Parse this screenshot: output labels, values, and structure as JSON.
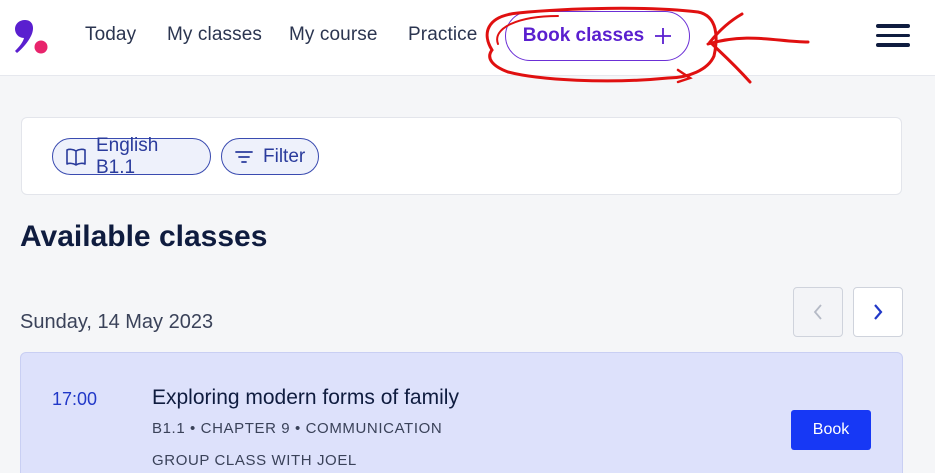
{
  "nav": {
    "items": [
      {
        "label": "Today"
      },
      {
        "label": "My classes"
      },
      {
        "label": "My course"
      },
      {
        "label": "Practice"
      }
    ],
    "book_label": "Book classes"
  },
  "filters": {
    "course_label": "English B1.1",
    "filter_label": "Filter"
  },
  "main": {
    "section_title": "Available classes",
    "date": "Sunday, 14 May 2023",
    "classes": [
      {
        "time": "17:00",
        "title": "Exploring modern forms of family",
        "meta": "B1.1 • CHAPTER 9 • COMMUNICATION",
        "teacher": "GROUP CLASS WITH JOEL",
        "book_label": "Book"
      }
    ]
  },
  "colors": {
    "brand_purple": "#6b2fd6",
    "brand_pink": "#e8246c",
    "accent_blue": "#1738f5",
    "annotation_red": "#e01010"
  },
  "icons": [
    "brand-logo-icon",
    "plus-icon",
    "menu-icon",
    "book-icon",
    "filter-icon",
    "chevron-left-icon",
    "chevron-right-icon"
  ]
}
